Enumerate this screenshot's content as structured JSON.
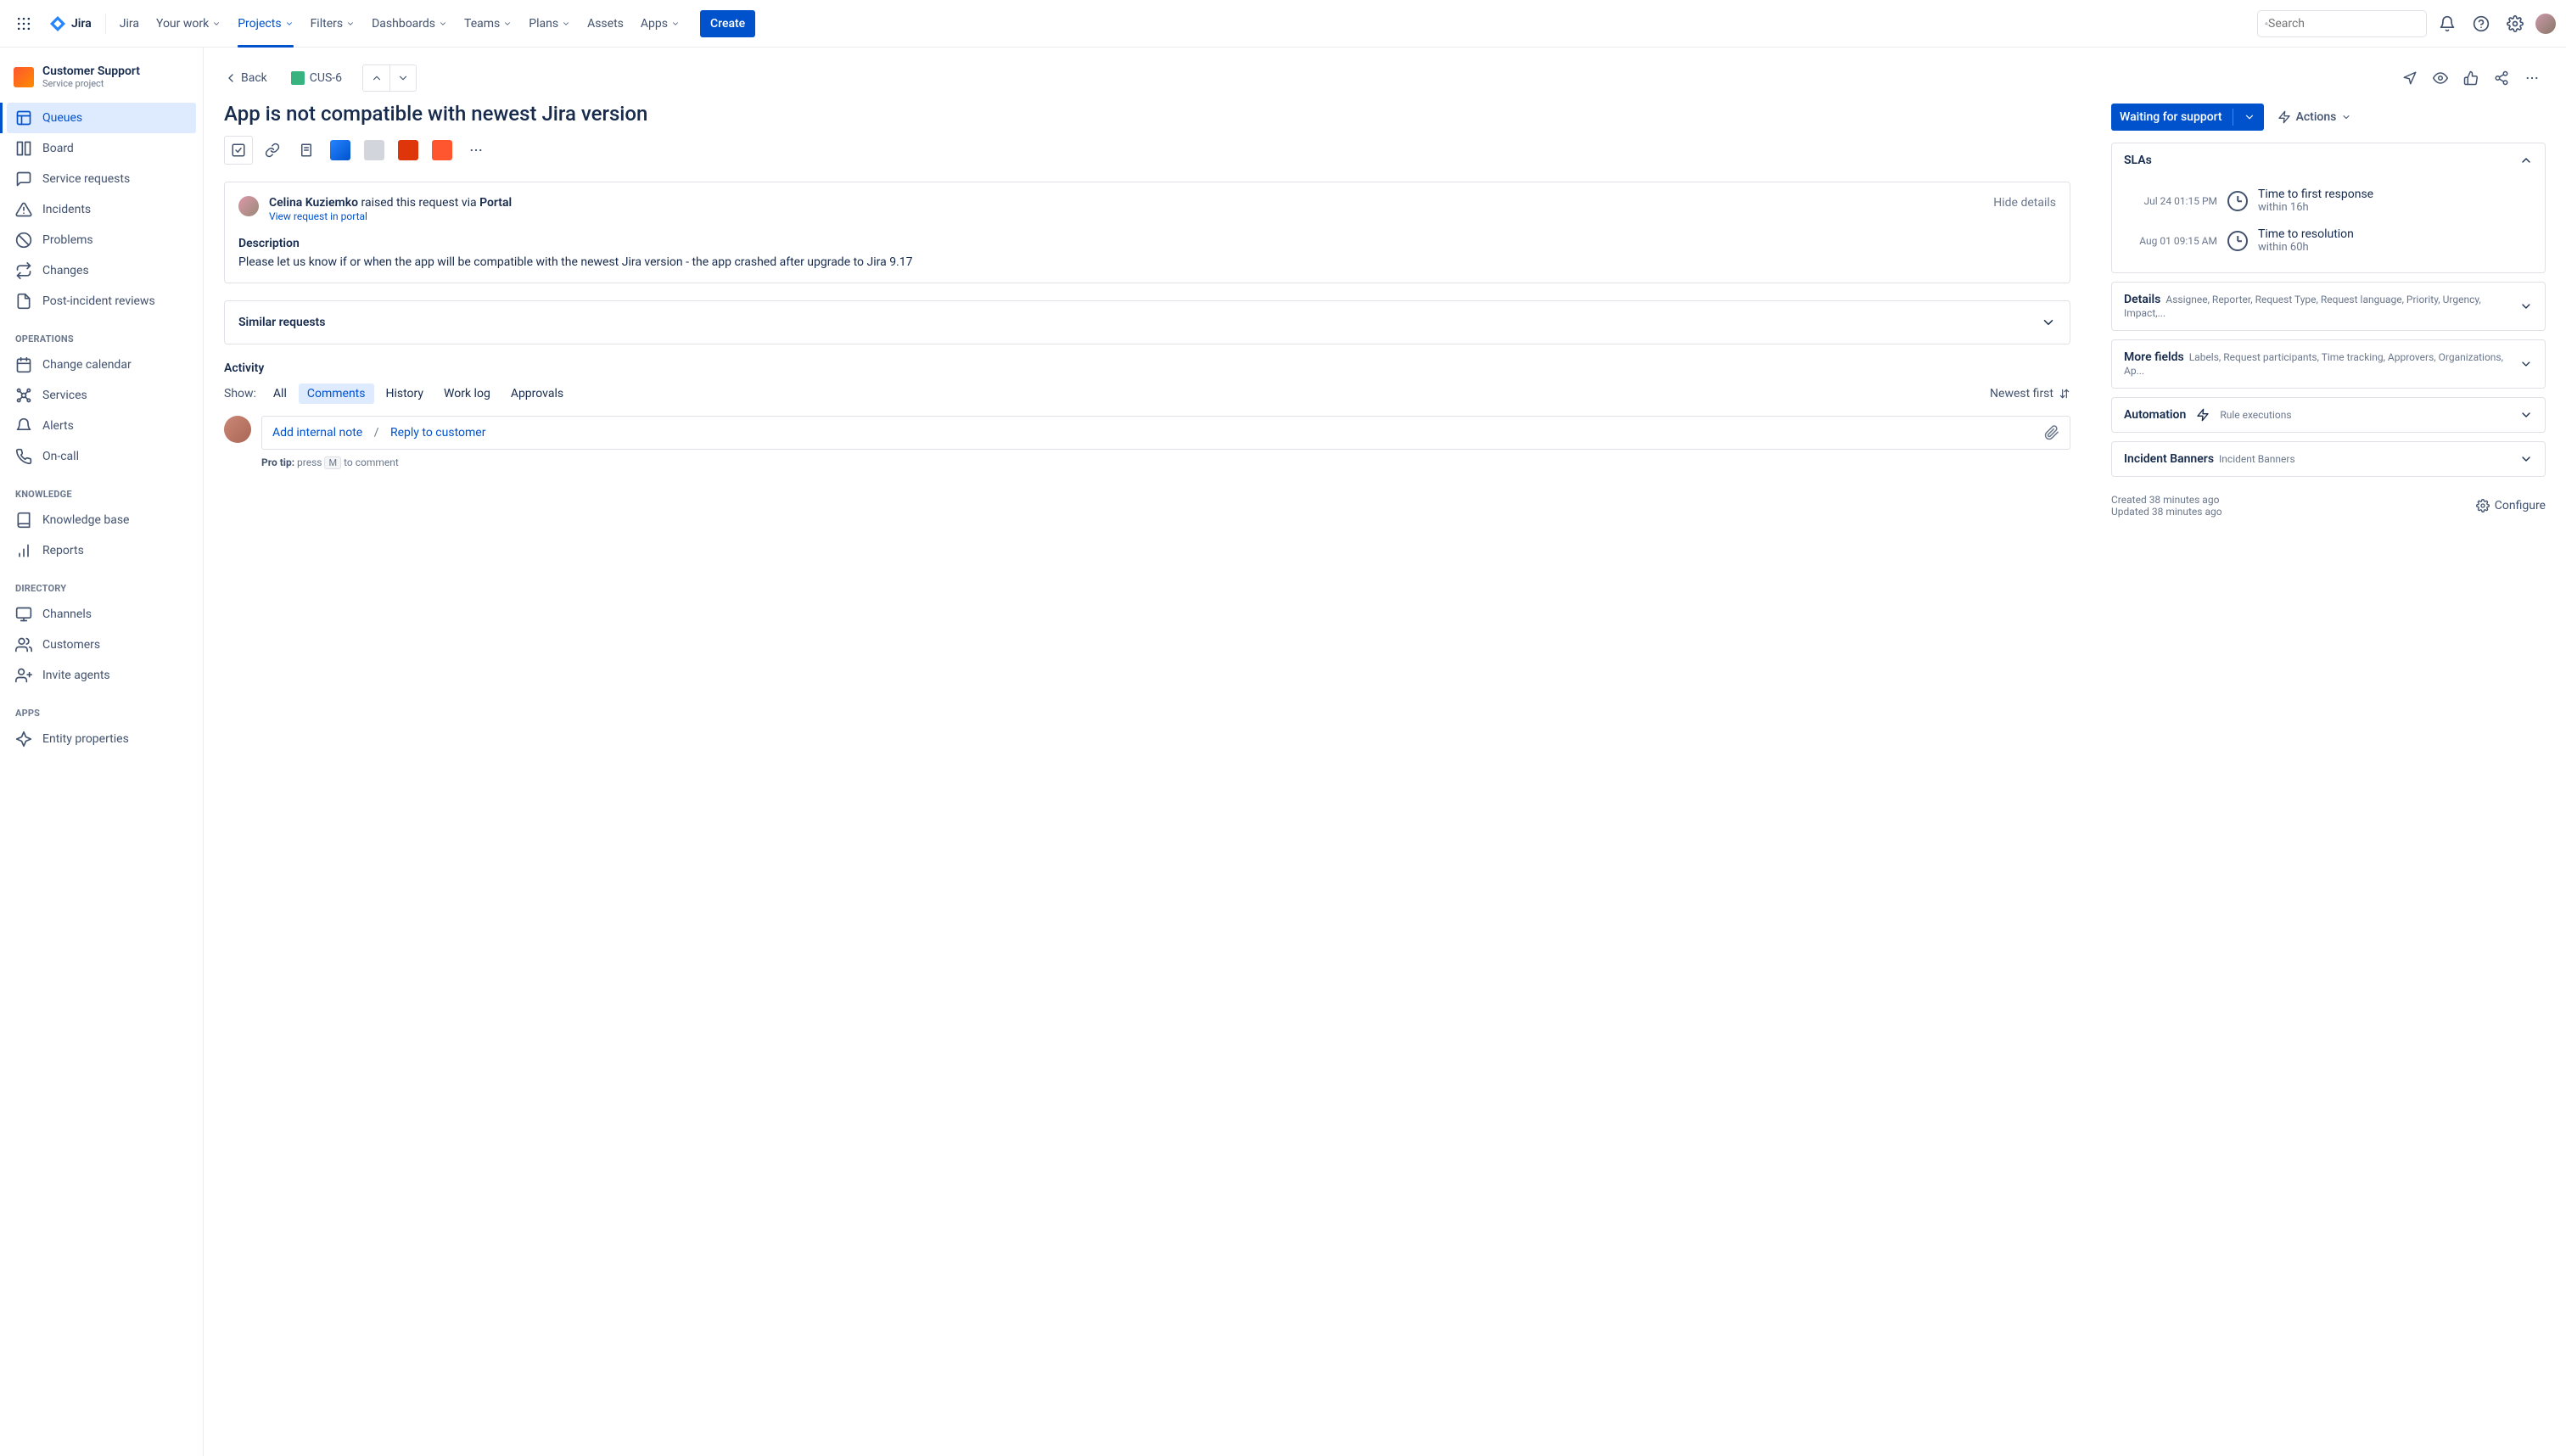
{
  "topnav": {
    "product": "Jira",
    "items": [
      "Your work",
      "Projects",
      "Filters",
      "Dashboards",
      "Teams",
      "Plans",
      "Assets",
      "Apps"
    ],
    "active_index": 1,
    "create": "Create",
    "search_placeholder": "Search"
  },
  "sidebar": {
    "project_name": "Customer Support",
    "project_type": "Service project",
    "main_items": [
      "Queues",
      "Board",
      "Service requests",
      "Incidents",
      "Problems",
      "Changes",
      "Post-incident reviews"
    ],
    "main_active_index": 0,
    "sections": {
      "operations": {
        "label": "OPERATIONS",
        "items": [
          "Change calendar",
          "Services",
          "Alerts",
          "On-call"
        ]
      },
      "knowledge": {
        "label": "KNOWLEDGE",
        "items": [
          "Knowledge base",
          "Reports"
        ]
      },
      "directory": {
        "label": "DIRECTORY",
        "items": [
          "Channels",
          "Customers",
          "Invite agents"
        ]
      },
      "apps": {
        "label": "APPS",
        "items": [
          "Entity properties"
        ]
      }
    }
  },
  "breadcrumb": {
    "back": "Back",
    "issue_key": "CUS-6"
  },
  "issue": {
    "title": "App is not compatible with newest Jira version",
    "requester": "Celina Kuziemko",
    "raised_text": " raised this request via ",
    "via": "Portal",
    "view_portal": "View request in portal",
    "hide_details": "Hide details",
    "description_label": "Description",
    "description": "Please let us know if or when the app will be compatible with the newest Jira version - the app crashed after upgrade to Jira 9.17"
  },
  "similar": {
    "title": "Similar requests"
  },
  "activity": {
    "label": "Activity",
    "show": "Show:",
    "tabs": [
      "All",
      "Comments",
      "History",
      "Work log",
      "Approvals"
    ],
    "active_tab_index": 1,
    "sort": "Newest first",
    "add_note": "Add internal note",
    "reply": "Reply to customer",
    "protip_label": "Pro tip:",
    "protip_press": " press ",
    "protip_key": "M",
    "protip_rest": " to comment"
  },
  "status": {
    "value": "Waiting for support",
    "actions": "Actions"
  },
  "slas": {
    "title": "SLAs",
    "rows": [
      {
        "time": "Jul 24 01:15 PM",
        "name": "Time to first response",
        "due": "within 16h"
      },
      {
        "time": "Aug 01 09:15 AM",
        "name": "Time to resolution",
        "due": "within 60h"
      }
    ]
  },
  "panels": {
    "details": {
      "title": "Details",
      "subtitle": "Assignee, Reporter, Request Type, Request language, Priority, Urgency, Impact,..."
    },
    "more_fields": {
      "title": "More fields",
      "subtitle": "Labels, Request participants, Time tracking, Approvers, Organizations, Ap..."
    },
    "automation": {
      "title": "Automation",
      "subtitle": "Rule executions"
    },
    "incident": {
      "title": "Incident Banners",
      "subtitle": "Incident Banners"
    }
  },
  "meta": {
    "created": "Created 38 minutes ago",
    "updated": "Updated 38 minutes ago",
    "configure": "Configure"
  }
}
